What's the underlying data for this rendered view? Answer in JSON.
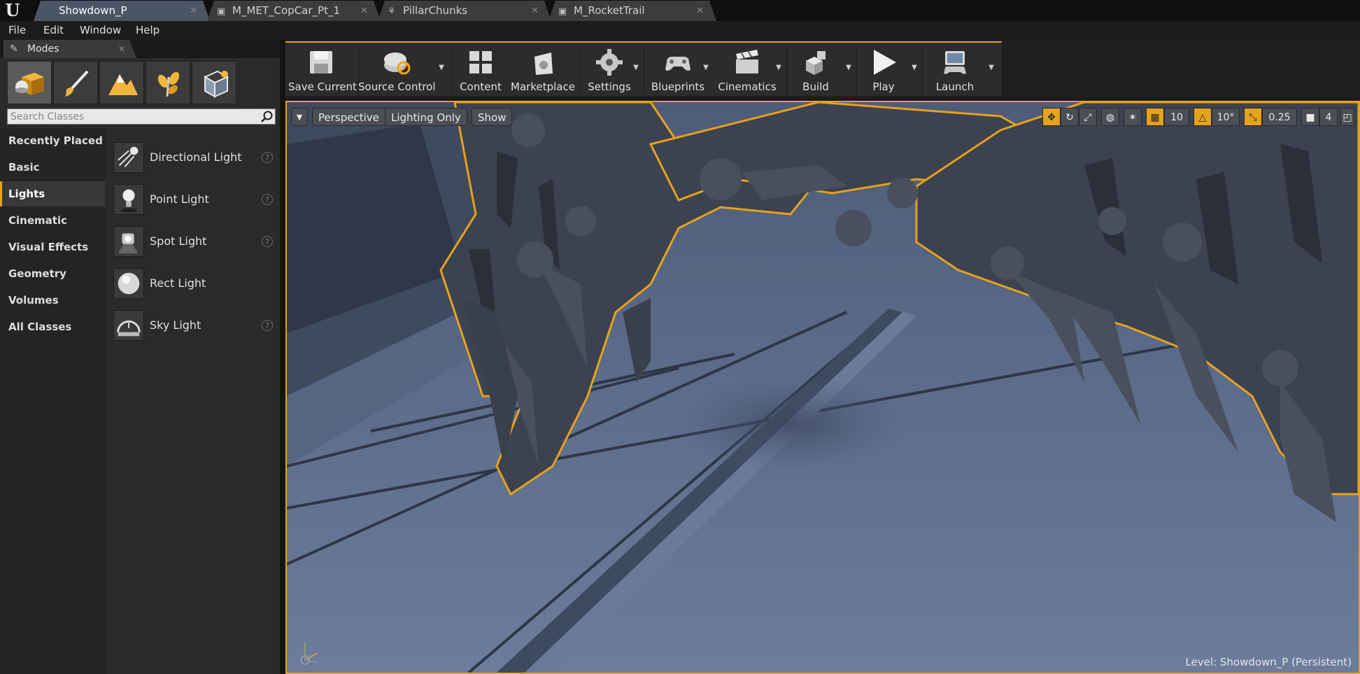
{
  "tabs": [
    {
      "label": "Showdown_P",
      "active": true,
      "icon": "level-icon"
    },
    {
      "label": "M_MET_CopCar_Pt_1",
      "active": false,
      "icon": "material-icon"
    },
    {
      "label": "PillarChunks",
      "active": false,
      "icon": "cascade-icon"
    },
    {
      "label": "M_RocketTrail",
      "active": false,
      "icon": "material-icon"
    }
  ],
  "menu": [
    "File",
    "Edit",
    "Window",
    "Help"
  ],
  "modes": {
    "tab_label": "Modes",
    "mode_buttons": [
      "place-mode-icon",
      "paint-mode-icon",
      "landscape-mode-icon",
      "foliage-mode-icon",
      "geometry-mode-icon"
    ],
    "search_placeholder": "Search Classes",
    "categories": [
      "Recently Placed",
      "Basic",
      "Lights",
      "Cinematic",
      "Visual Effects",
      "Geometry",
      "Volumes",
      "All Classes"
    ],
    "active_category": "Lights",
    "classes": [
      {
        "label": "Directional Light",
        "icon": "directional-light-icon"
      },
      {
        "label": "Point Light",
        "icon": "point-light-icon"
      },
      {
        "label": "Spot Light",
        "icon": "spot-light-icon"
      },
      {
        "label": "Rect Light",
        "icon": "rect-light-icon"
      },
      {
        "label": "Sky Light",
        "icon": "sky-light-icon"
      }
    ]
  },
  "toolbar": {
    "save_current": "Save Current",
    "source_control": "Source Control",
    "content": "Content",
    "marketplace": "Marketplace",
    "settings": "Settings",
    "blueprints": "Blueprints",
    "cinematics": "Cinematics",
    "build": "Build",
    "play": "Play",
    "launch": "Launch"
  },
  "viewport": {
    "perspective": "Perspective",
    "view_mode": "Lighting Only",
    "show": "Show",
    "grid_snap": "10",
    "rotation_snap": "10°",
    "scale_snap": "0.25",
    "camera_speed": "4",
    "level": "Level:  Showdown_P (Persistent)",
    "accent": "#e5a21c"
  }
}
